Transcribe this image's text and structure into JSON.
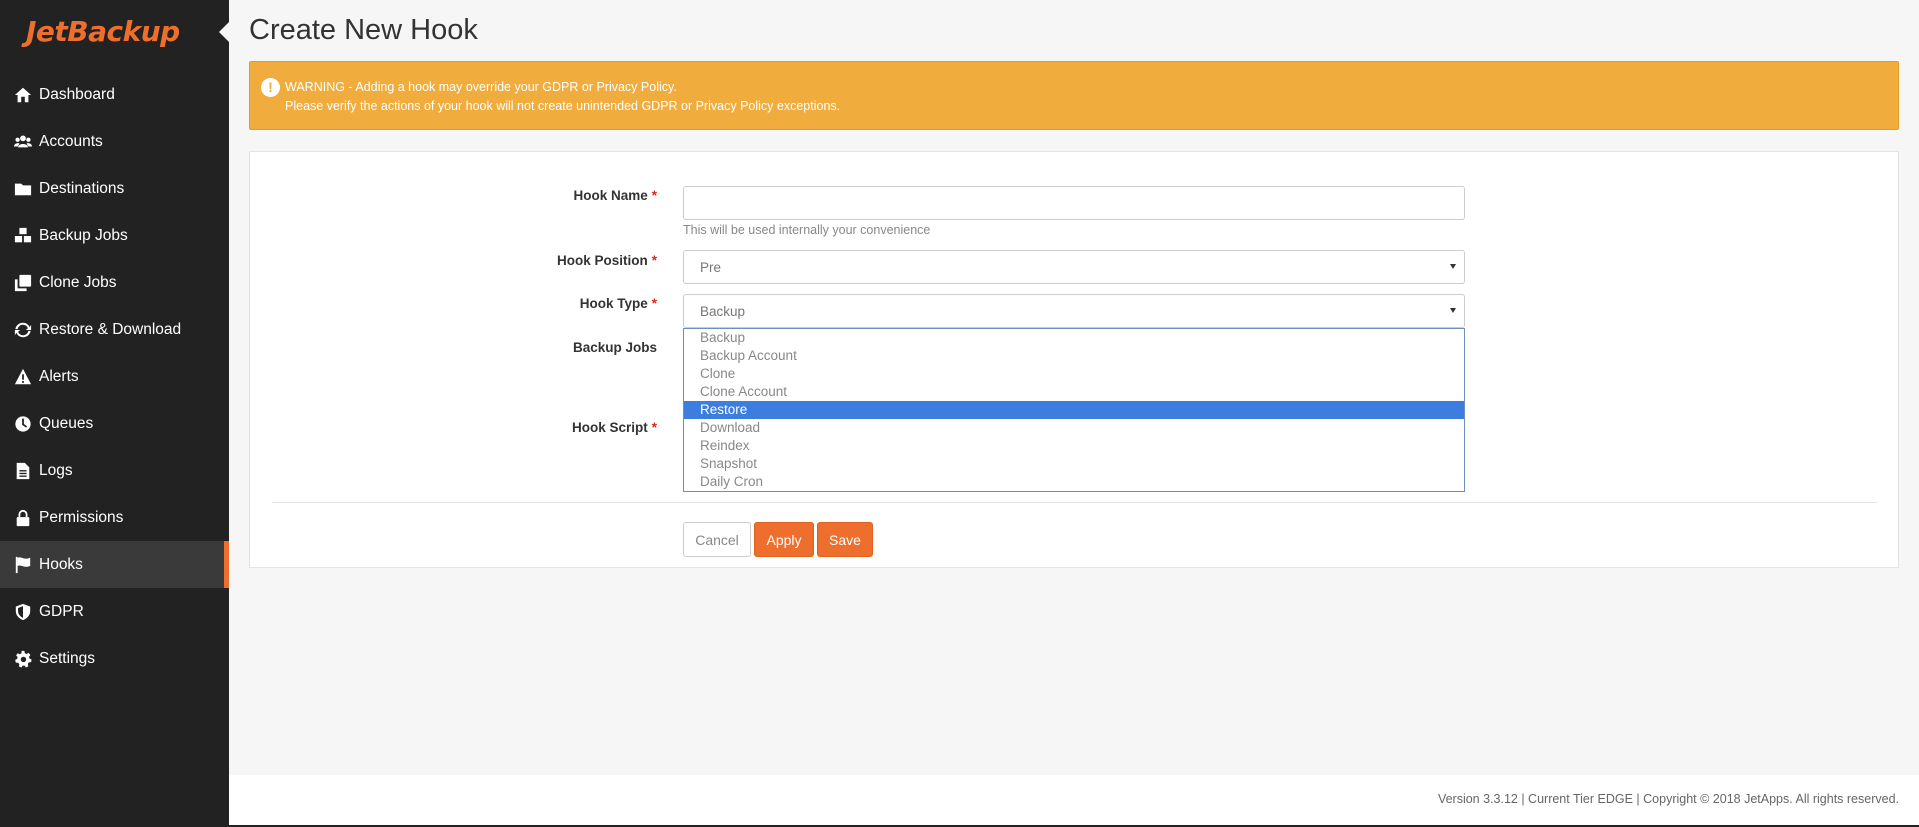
{
  "brand": {
    "logo_text": "JetBackup",
    "accent_color": "#ee6f2d"
  },
  "sidebar": {
    "items": [
      {
        "label": "Dashboard",
        "icon": "home-icon"
      },
      {
        "label": "Accounts",
        "icon": "users-icon"
      },
      {
        "label": "Destinations",
        "icon": "folder-icon"
      },
      {
        "label": "Backup Jobs",
        "icon": "cubes-icon"
      },
      {
        "label": "Clone Jobs",
        "icon": "clone-icon"
      },
      {
        "label": "Restore & Download",
        "icon": "refresh-icon"
      },
      {
        "label": "Alerts",
        "icon": "warning-icon"
      },
      {
        "label": "Queues",
        "icon": "clock-icon"
      },
      {
        "label": "Logs",
        "icon": "file-icon"
      },
      {
        "label": "Permissions",
        "icon": "lock-icon"
      },
      {
        "label": "Hooks",
        "icon": "flag-icon",
        "active": true
      },
      {
        "label": "GDPR",
        "icon": "shield-icon"
      },
      {
        "label": "Settings",
        "icon": "gear-icon"
      }
    ]
  },
  "page": {
    "title": "Create New Hook"
  },
  "alert": {
    "line1": "WARNING - Adding a hook may override your GDPR or Privacy Policy.",
    "line2": "Please verify the actions of your hook will not create unintended GDPR or Privacy Policy exceptions.",
    "color": "#f0ac3d"
  },
  "form": {
    "hook_name": {
      "label": "Hook Name",
      "value": "",
      "help": "This will be used internally your convenience"
    },
    "hook_position": {
      "label": "Hook Position",
      "value": "Pre"
    },
    "hook_type": {
      "label": "Hook Type",
      "value": "Backup",
      "options": [
        "Backup",
        "Backup Account",
        "Clone",
        "Clone Account",
        "Restore",
        "Download",
        "Reindex",
        "Snapshot",
        "Daily Cron"
      ],
      "highlighted": "Restore"
    },
    "backup_jobs": {
      "label": "Backup Jobs"
    },
    "hook_script": {
      "label": "Hook Script"
    },
    "required_marker": "*"
  },
  "buttons": {
    "cancel": "Cancel",
    "apply": "Apply",
    "save": "Save"
  },
  "footer": {
    "text": "Version 3.3.12 | Current Tier EDGE | Copyright © 2018 JetApps. All rights reserved."
  }
}
